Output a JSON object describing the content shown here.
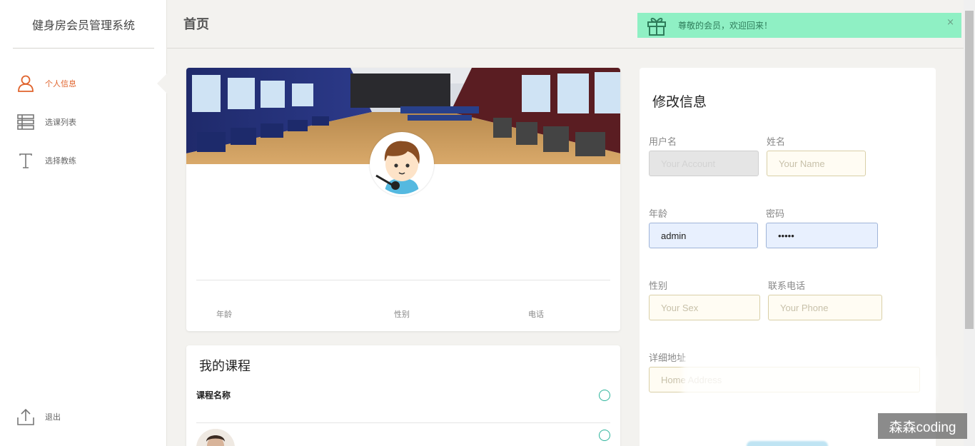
{
  "sidebar": {
    "brand": "健身房会员管理系统",
    "items": [
      {
        "label": "个人信息",
        "icon": "user-icon",
        "active": true
      },
      {
        "label": "选课列表",
        "icon": "list-icon",
        "active": false
      },
      {
        "label": "选择教练",
        "icon": "text-t-icon",
        "active": false
      }
    ],
    "logout": {
      "label": "退出",
      "icon": "upload-icon"
    }
  },
  "header": {
    "title": "首页",
    "alert": {
      "message": "尊敬的会员，欢迎回来！",
      "close": "×",
      "icon": "gift-icon"
    }
  },
  "profile": {
    "stats": {
      "age_label": "年龄",
      "sex_label": "性别",
      "phone_label": "电话"
    }
  },
  "courses": {
    "title": "我的课程",
    "header": "课程名称"
  },
  "edit": {
    "title": "修改信息",
    "username": {
      "label": "用户名",
      "placeholder": "Your Account"
    },
    "name": {
      "label": "姓名",
      "placeholder": "Your Name"
    },
    "age": {
      "label": "年龄",
      "value": "admin"
    },
    "password": {
      "label": "密码",
      "value": "•••••"
    },
    "sex": {
      "label": "性别",
      "placeholder": "Your Sex"
    },
    "phone": {
      "label": "联系电话",
      "placeholder": "Your Phone"
    },
    "address": {
      "label": "详细地址",
      "placeholder": "Home Address"
    }
  },
  "watermark": "森森coding",
  "colors": {
    "accent": "#e0632c",
    "alert_bg": "#8ff0c4",
    "radio": "#2bb39a"
  }
}
